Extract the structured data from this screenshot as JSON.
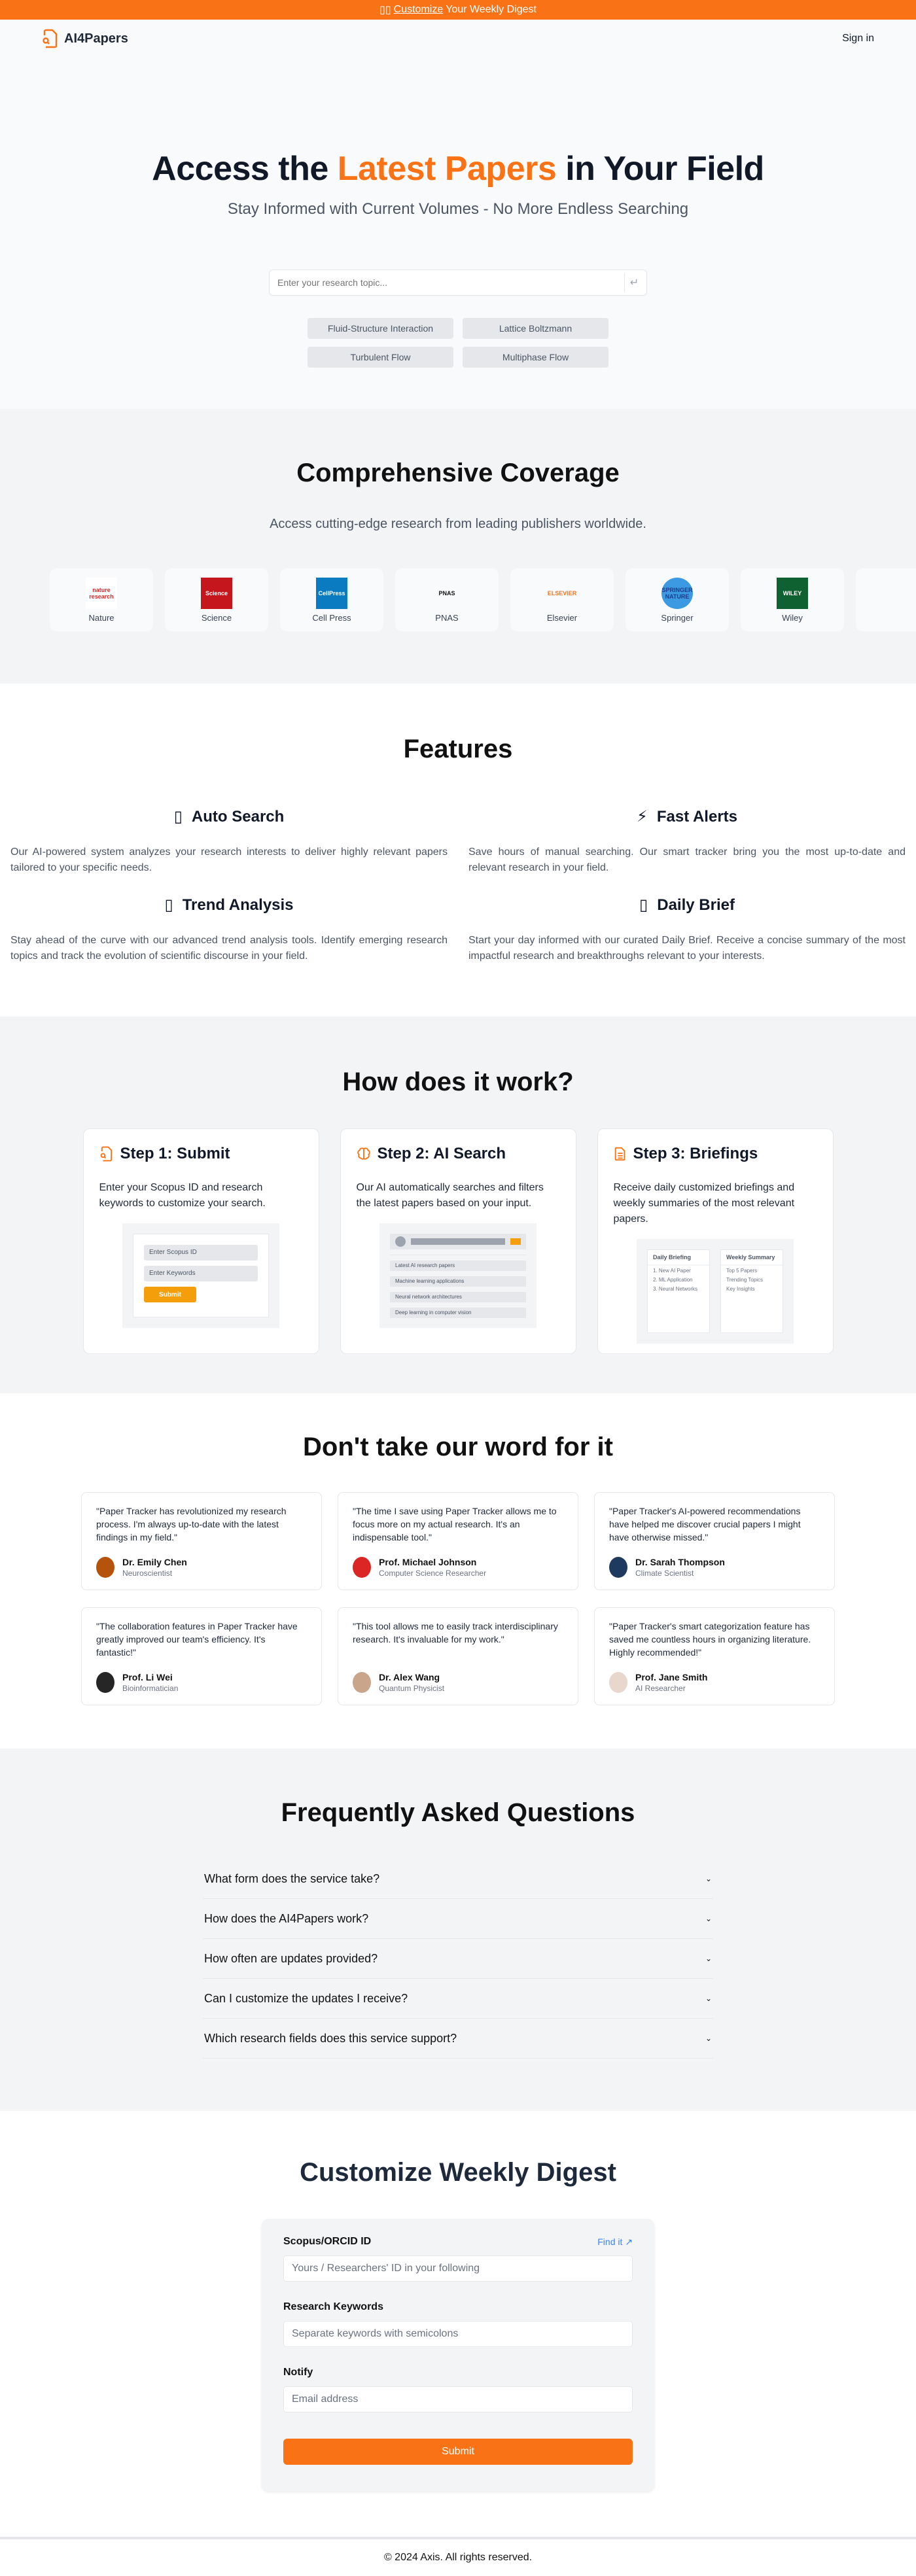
{
  "banner": {
    "icon": "gift-icon",
    "link": "Customize",
    "text": "Your Weekly Digest"
  },
  "nav": {
    "brand": "AI4Papers",
    "signin": "Sign in"
  },
  "hero": {
    "title_pre": "Access the ",
    "title_accent": "Latest Papers",
    "title_post": " in Your Field",
    "subtitle": "Stay Informed with Current Volumes - No More Endless Searching",
    "search_placeholder": "Enter your research topic...",
    "chips": [
      "Fluid-Structure Interaction",
      "Lattice Boltzmann",
      "Turbulent Flow",
      "Multiphase Flow"
    ]
  },
  "coverage": {
    "title": "Comprehensive Coverage",
    "subtitle": "Access cutting-edge research from leading publishers worldwide.",
    "publishers": [
      {
        "name": "Nature",
        "logo": "nature research",
        "color": "#dc2626",
        "bg": "#ffffff"
      },
      {
        "name": "Science",
        "logo": "Science",
        "color": "#ffffff",
        "bg": "#c4161c"
      },
      {
        "name": "Cell Press",
        "logo": "CellPress",
        "color": "#ffffff",
        "bg": "#0a7bc1"
      },
      {
        "name": "PNAS",
        "logo": "PNAS",
        "color": "#111111",
        "bg": "#f8fafc"
      },
      {
        "name": "Elsevier",
        "logo": "ELSEVIER",
        "color": "#f97316",
        "bg": "#f8fafc"
      },
      {
        "name": "Springer",
        "logo": "SPRINGER NATURE",
        "color": "#1e3a8a",
        "bg": "#3b9ae1"
      },
      {
        "name": "Wiley",
        "logo": "WILEY",
        "color": "#ffffff",
        "bg": "#0f6132"
      },
      {
        "name": "",
        "logo": "",
        "color": "#ffffff",
        "bg": "#f8fafc"
      }
    ]
  },
  "features": {
    "title": "Features",
    "items": [
      {
        "icon": "search-icon",
        "glyph": "▯",
        "title": "Auto Search",
        "text": "Our AI-powered system analyzes your research interests to deliver highly relevant papers tailored to your specific needs."
      },
      {
        "icon": "lightning-icon",
        "glyph": "⚡",
        "title": "Fast Alerts",
        "text": "Save hours of manual searching. Our smart tracker bring you the most up-to-date and relevant research in your field."
      },
      {
        "icon": "trend-icon",
        "glyph": "▯",
        "title": "Trend Analysis",
        "text": "Stay ahead of the curve with our advanced trend analysis tools. Identify emerging research topics and track the evolution of scientific discourse in your field."
      },
      {
        "icon": "brief-icon",
        "glyph": "▯",
        "title": "Daily Brief",
        "text": "Start your day informed with our curated Daily Brief. Receive a concise summary of the most impactful research and breakthroughs relevant to your interests."
      }
    ]
  },
  "how": {
    "title": "How does it work?",
    "steps": [
      {
        "title": "Step 1: Submit",
        "text": "Enter your Scopus ID and research keywords to customize your search.",
        "mock": {
          "fields": [
            "Enter Scopus ID",
            "Enter Keywords"
          ],
          "button": "Submit"
        }
      },
      {
        "title": "Step 2: AI Search",
        "text": "Our AI automatically searches and filters the latest papers based on your input.",
        "mock": {
          "results": [
            "Latest AI research papers",
            "Machine learning applications",
            "Neural network architectures",
            "Deep learning in computer vision"
          ]
        }
      },
      {
        "title": "Step 3: Briefings",
        "text": "Receive daily customized briefings and weekly summaries of the most relevant papers.",
        "mock": {
          "daily_title": "Daily Briefing",
          "daily": [
            "1. New AI Paper",
            "2. ML Application",
            "3. Neural Networks"
          ],
          "weekly_title": "Weekly Summary",
          "weekly": [
            "Top 5 Papers",
            "Trending Topics",
            "Key Insights"
          ]
        }
      }
    ]
  },
  "testimonials": {
    "title": "Don't take our word for it",
    "items": [
      {
        "quote": "\"Paper Tracker has revolutionized my research process. I'm always up-to-date with the latest findings in my field.\"",
        "name": "Dr. Emily Chen",
        "role": "Neuroscientist",
        "avatar_color": "#b45309"
      },
      {
        "quote": "\"The time I save using Paper Tracker allows me to focus more on my actual research. It's an indispensable tool.\"",
        "name": "Prof. Michael Johnson",
        "role": "Computer Science Researcher",
        "avatar_color": "#dc2626"
      },
      {
        "quote": "\"Paper Tracker's AI-powered recommendations have helped me discover crucial papers I might have otherwise missed.\"",
        "name": "Dr. Sarah Thompson",
        "role": "Climate Scientist",
        "avatar_color": "#1e3a5f"
      },
      {
        "quote": "\"The collaboration features in Paper Tracker have greatly improved our team's efficiency. It's fantastic!\"",
        "name": "Prof. Li Wei",
        "role": "Bioinformatician",
        "avatar_color": "#262626"
      },
      {
        "quote": "\"This tool allows me to easily track interdisciplinary research. It's invaluable for my work.\"",
        "name": "Dr. Alex Wang",
        "role": "Quantum Physicist",
        "avatar_color": "#c9a58c"
      },
      {
        "quote": "\"Paper Tracker's smart categorization feature has saved me countless hours in organizing literature. Highly recommended!\"",
        "name": "Prof. Jane Smith",
        "role": "AI Researcher",
        "avatar_color": "#e7d7cc"
      }
    ]
  },
  "faq": {
    "title": "Frequently Asked Questions",
    "items": [
      "What form does the service take?",
      "How does the AI4Papers work?",
      "How often are updates provided?",
      "Can I customize the updates I receive?",
      "Which research fields does this service support?"
    ]
  },
  "digest": {
    "title": "Customize Weekly Digest",
    "id_label": "Scopus/ORCID ID",
    "find_it": "Find it",
    "id_placeholder": "Yours / Researchers' ID in your following",
    "kw_label": "Research Keywords",
    "kw_placeholder": "Separate keywords with semicolons",
    "notify_label": "Notify",
    "email_placeholder": "Email address",
    "submit": "Submit"
  },
  "footer": {
    "text": "© 2024 Axis. All rights reserved."
  },
  "colors": {
    "accent": "#f97316",
    "link": "#3b82f6"
  }
}
